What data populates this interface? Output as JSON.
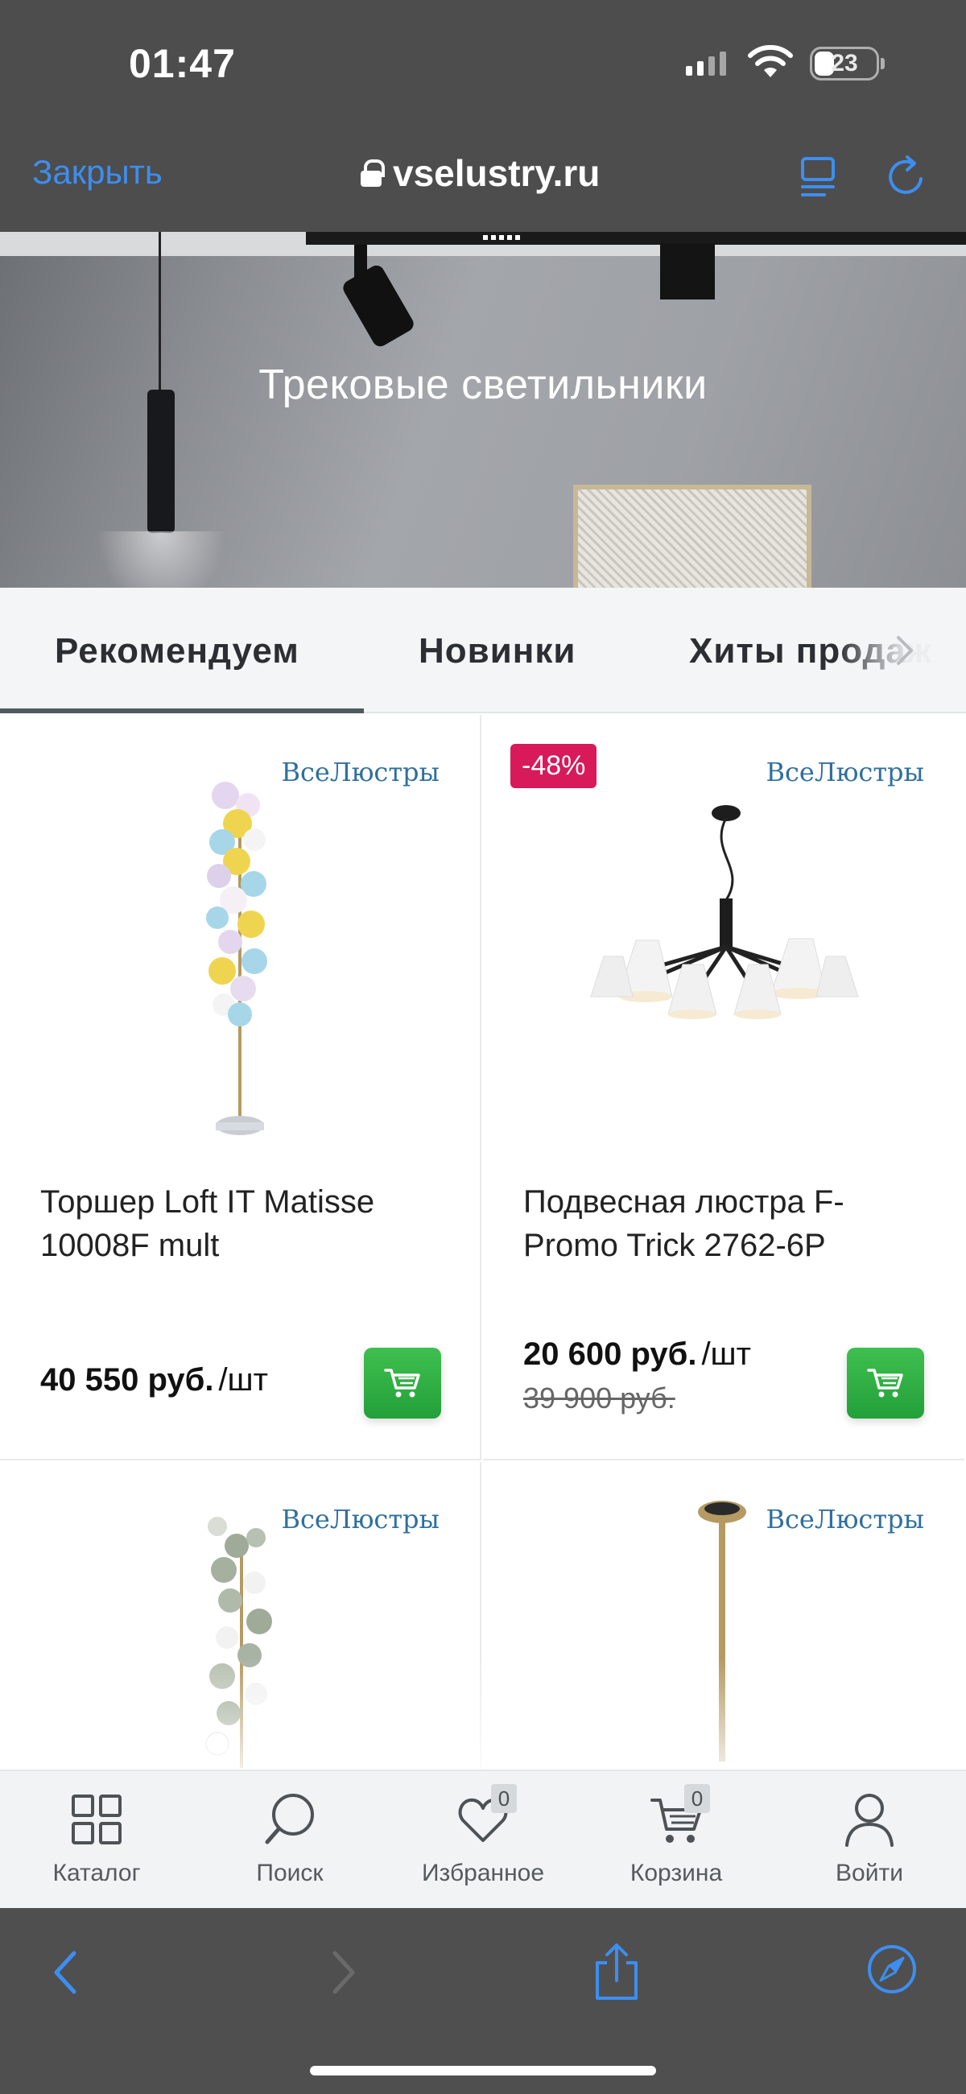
{
  "status_bar": {
    "time": "01:47",
    "battery": "23",
    "signal_icon": "cellular-signal-icon",
    "wifi_icon": "wifi-icon"
  },
  "browser": {
    "close_label": "Закрыть",
    "url": "vselustry.ru",
    "accent_color": "#3d8ef0"
  },
  "hero": {
    "title": "Трековые светильники"
  },
  "tabs": [
    {
      "label": "Рекомендуем",
      "active": true
    },
    {
      "label": "Новинки",
      "active": false
    },
    {
      "label": "Хиты продаж",
      "active": false
    }
  ],
  "products": [
    {
      "brand": "ВсеЛюстры",
      "name": "Торшер Loft IT Matisse 10008F mult",
      "price": "40 550 руб.",
      "unit": "/шт",
      "old_price": "",
      "discount": ""
    },
    {
      "brand": "ВсеЛюстры",
      "name": "Подвесная люстра F-Promo Trick 2762-6P",
      "price": "20 600 руб.",
      "unit": "/шт",
      "old_price": "39 900 руб.",
      "discount": "-48%"
    },
    {
      "brand": "ВсеЛюстры",
      "name": "",
      "price": "",
      "unit": "",
      "old_price": "",
      "discount": ""
    },
    {
      "brand": "ВсеЛюстры",
      "name": "",
      "price": "",
      "unit": "",
      "old_price": "",
      "discount": ""
    }
  ],
  "site_nav": [
    {
      "label": "Каталог",
      "icon": "grid-icon"
    },
    {
      "label": "Поиск",
      "icon": "search-icon"
    },
    {
      "label": "Избранное",
      "icon": "heart-icon",
      "count": "0"
    },
    {
      "label": "Корзина",
      "icon": "cart-icon",
      "count": "0"
    },
    {
      "label": "Войти",
      "icon": "user-icon"
    }
  ],
  "colors": {
    "discount_badge": "#d8195a",
    "cart_button": "#2eaf43",
    "status_bar_bg": "#4d4d4d"
  }
}
